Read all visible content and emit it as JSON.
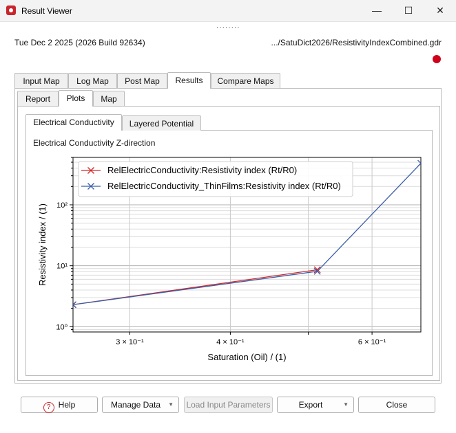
{
  "window": {
    "title": "Result Viewer",
    "minimize": "—",
    "maximize": "☐",
    "close": "✕"
  },
  "header": {
    "date": "Tue Dec 2 2025 (2026 Build 92634)",
    "path": ".../SatuDict2026/ResistivityIndexCombined.gdr",
    "status_color": "#d0021b"
  },
  "tabs_main": [
    "Input Map",
    "Log Map",
    "Post Map",
    "Results",
    "Compare Maps"
  ],
  "tabs_sub": [
    "Report",
    "Plots",
    "Map"
  ],
  "tabs_plot": [
    "Electrical Conductivity",
    "Layered Potential"
  ],
  "plot_title": "Electrical Conductivity Z-direction",
  "chart_data": {
    "type": "line",
    "xscale": "log",
    "yscale": "log",
    "xlabel": "Saturation (Oil) / (1)",
    "ylabel": "Resistivity index / (1)",
    "xlim": [
      0.255,
      0.69
    ],
    "ylim": [
      0.82,
      600
    ],
    "xticks": [
      {
        "value": 0.3,
        "label": "3 × 10⁻¹"
      },
      {
        "value": 0.4,
        "label": "4 × 10⁻¹"
      },
      {
        "value": 0.6,
        "label": "6 × 10⁻¹"
      }
    ],
    "yticks": [
      {
        "value": 1,
        "label": "10⁰"
      },
      {
        "value": 10,
        "label": "10¹"
      },
      {
        "value": 100,
        "label": "10²"
      }
    ],
    "grid": true,
    "legend": "top-left",
    "series": [
      {
        "name": "RelElectricConductivity:Resistivity index (Rt/R0)",
        "color": "#d62728",
        "points": [
          [
            0.255,
            2.3
          ],
          [
            0.513,
            8.6
          ]
        ]
      },
      {
        "name": "RelElectricConductivity_ThinFilms:Resistivity index (Rt/R0)",
        "color": "#3b5ea8",
        "points": [
          [
            0.255,
            2.3
          ],
          [
            0.513,
            8.1
          ],
          [
            0.69,
            480
          ]
        ]
      }
    ]
  },
  "buttons": {
    "help": "Help",
    "manage": "Manage Data",
    "load": "Load Input Parameters",
    "export": "Export",
    "close": "Close"
  }
}
